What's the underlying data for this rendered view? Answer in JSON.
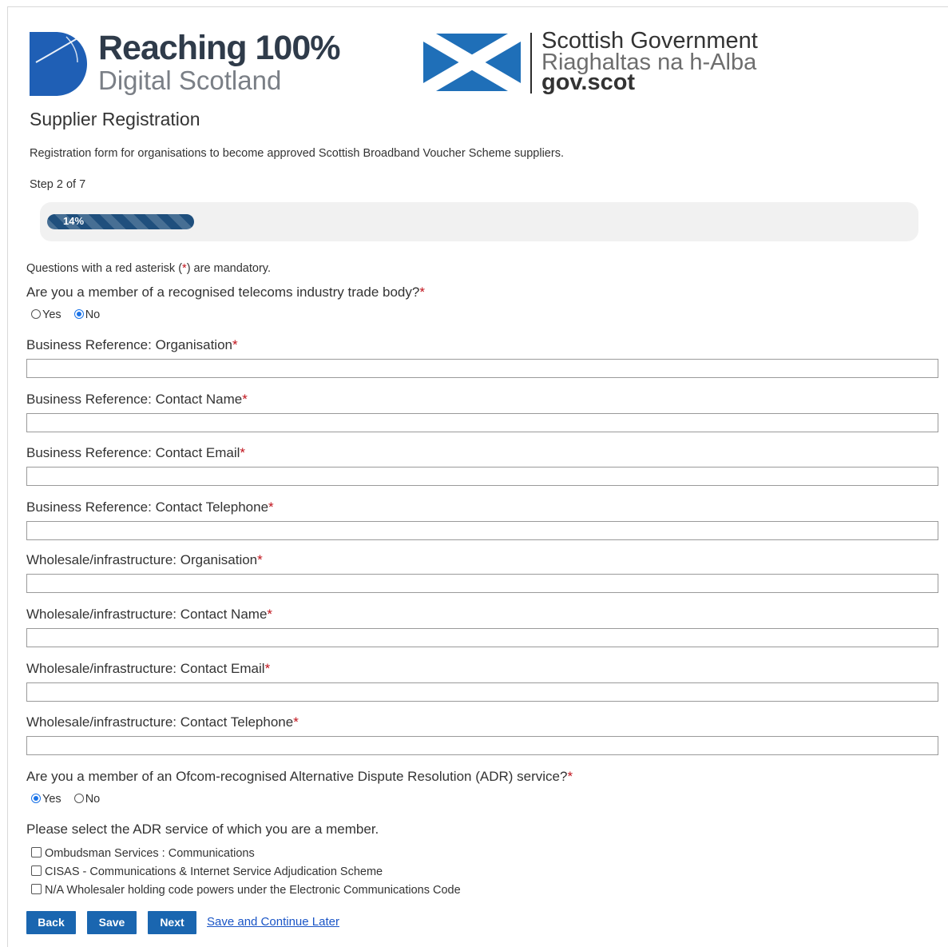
{
  "header": {
    "logo_r100": {
      "line1": "Reaching 100%",
      "line2": "Digital Scotland"
    },
    "logo_sg": {
      "line1": "Scottish Government",
      "line2": "Riaghaltas na h-Alba",
      "line3": "gov.scot"
    }
  },
  "page": {
    "title": "Supplier Registration",
    "description": "Registration form for organisations to become approved Scottish Broadband Voucher Scheme suppliers.",
    "step": "Step 2 of 7",
    "progress": {
      "label": "14%",
      "value_percent": 17
    }
  },
  "form": {
    "mandatory_note": {
      "before": "Questions with a red asterisk (",
      "asterisk": "*",
      "after": ") are mandatory."
    },
    "trade_body": {
      "question": "Are you a member of a recognised telecoms industry trade body?",
      "asterisk": "*",
      "options": [
        "Yes",
        "No"
      ],
      "selected": "No"
    },
    "fields": [
      {
        "label": "Business Reference: Organisation",
        "asterisk": "*",
        "value": ""
      },
      {
        "label": "Business Reference: Contact Name",
        "asterisk": "*",
        "value": ""
      },
      {
        "label": "Business Reference: Contact Email",
        "asterisk": "*",
        "value": ""
      },
      {
        "label": "Business Reference: Contact Telephone",
        "asterisk": "*",
        "value": ""
      },
      {
        "label": "Wholesale/infrastructure: Organisation",
        "asterisk": "*",
        "value": ""
      },
      {
        "label": "Wholesale/infrastructure: Contact Name",
        "asterisk": "*",
        "value": ""
      },
      {
        "label": "Wholesale/infrastructure: Contact Email",
        "asterisk": "*",
        "value": ""
      },
      {
        "label": "Wholesale/infrastructure: Contact Telephone",
        "asterisk": "*",
        "value": ""
      }
    ],
    "adr": {
      "question": "Are you a member of an Ofcom-recognised Alternative Dispute Resolution (ADR) service?",
      "asterisk": "*",
      "options": [
        "Yes",
        "No"
      ],
      "selected": "Yes"
    },
    "adr_select": {
      "question": "Please select the ADR service of which you are a member.",
      "options": [
        "Ombudsman Services : Communications",
        "CISAS - Communications & Internet Service Adjudication Scheme",
        "N/A Wholesaler holding code powers under the Electronic Communications Code"
      ]
    }
  },
  "actions": {
    "back": "Back",
    "save": "Save",
    "next": "Next",
    "save_later": "Save and Continue Later"
  },
  "colors": {
    "primary_button": "#1a66b0",
    "progress_fill": "#1f4f7d",
    "asterisk": "#c0131c",
    "link": "#1a55c6",
    "r100_brand": "#1f5fb5",
    "saltire_blue": "#1f6fb8"
  }
}
